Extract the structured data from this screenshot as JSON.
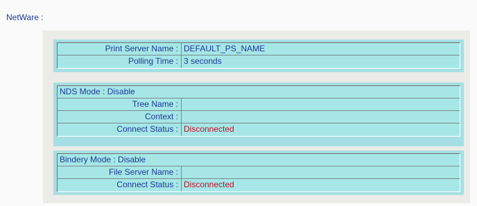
{
  "page": {
    "title": "NetWare :"
  },
  "general": {
    "rows": [
      {
        "label": "Print Server Name :",
        "value": "DEFAULT_PS_NAME"
      },
      {
        "label": "Polling Time :",
        "value": "3 seconds"
      }
    ]
  },
  "nds": {
    "header": "NDS Mode : Disable",
    "rows": [
      {
        "label": "Tree Name :",
        "value": ""
      },
      {
        "label": "Context :",
        "value": ""
      },
      {
        "label": "Connect Status :",
        "value": "Disconnected"
      }
    ]
  },
  "bindery": {
    "header": "Bindery Mode : Disable",
    "rows": [
      {
        "label": "File Server Name :",
        "value": ""
      },
      {
        "label": "Connect Status :",
        "value": "Disconnected"
      }
    ]
  },
  "colors": {
    "text": "#1c3a96",
    "status_red": "#c0102a",
    "panel_bg": "#a6e6e6",
    "group_bg": "#a6dfe3"
  }
}
